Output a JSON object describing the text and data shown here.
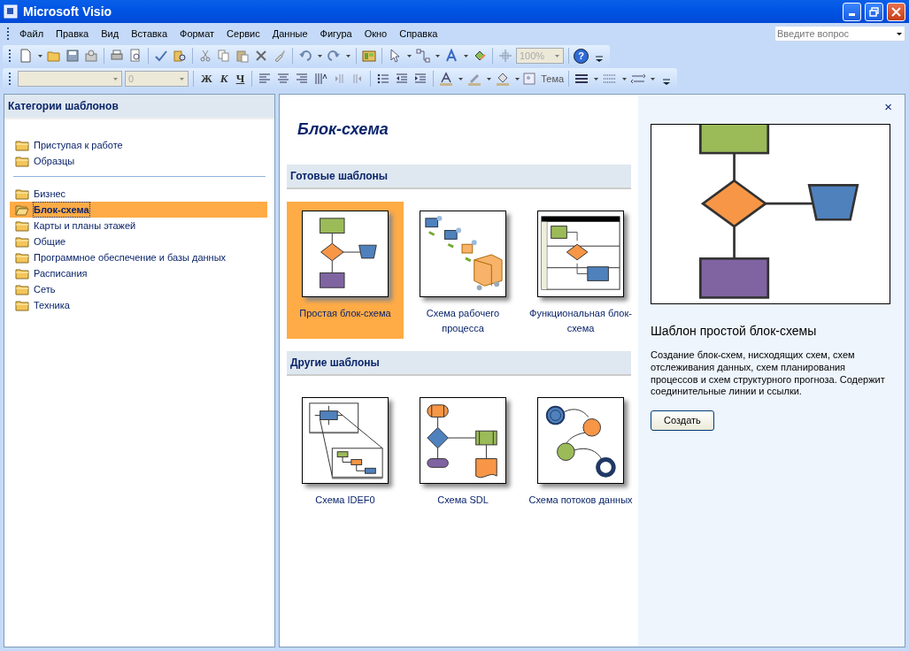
{
  "window": {
    "title": "Microsoft Visio"
  },
  "menu": [
    "Файл",
    "Правка",
    "Вид",
    "Вставка",
    "Формат",
    "Сервис",
    "Данные",
    "Фигура",
    "Окно",
    "Справка"
  ],
  "help_search": {
    "placeholder": "Введите вопрос"
  },
  "toolbar_standard": {
    "zoom": "100%",
    "help": "?"
  },
  "toolbar_format": {
    "size": "0",
    "bold": "Ж",
    "italic": "К",
    "underline": "Ч",
    "theme": "Тема"
  },
  "categories_panel": {
    "title": "Категории шаблонов",
    "groups": [
      [
        {
          "label": "Приступая к работе",
          "selected": false
        },
        {
          "label": "Образцы",
          "selected": false
        }
      ],
      [
        {
          "label": "Бизнес",
          "selected": false
        },
        {
          "label": "Блок-схема",
          "selected": true
        },
        {
          "label": "Карты и планы этажей",
          "selected": false
        },
        {
          "label": "Общие",
          "selected": false
        },
        {
          "label": "Программное обеспечение и базы данных",
          "selected": false
        },
        {
          "label": "Расписания",
          "selected": false
        },
        {
          "label": "Сеть",
          "selected": false
        },
        {
          "label": "Техника",
          "selected": false
        }
      ]
    ]
  },
  "gallery": {
    "title": "Блок-схема",
    "sections": [
      {
        "title": "Готовые шаблоны",
        "templates": [
          {
            "label": "Простая блок-схема",
            "kind": "flowchart",
            "selected": true
          },
          {
            "label": "Схема рабочего процесса",
            "kind": "workflow",
            "selected": false
          },
          {
            "label": "Функциональная блок-схема",
            "kind": "swimlane",
            "selected": false
          }
        ]
      },
      {
        "title": "Другие шаблоны",
        "templates": [
          {
            "label": "Схема IDEF0",
            "kind": "idef0",
            "selected": false
          },
          {
            "label": "Схема SDL",
            "kind": "sdl",
            "selected": false
          },
          {
            "label": "Схема потоков данных",
            "kind": "dataflow",
            "selected": false
          }
        ]
      }
    ]
  },
  "details": {
    "close": "×",
    "title": "Шаблон простой блок-схемы",
    "description": "Создание блок-схем, нисходящих схем, схем отслеживания данных, схем планирования процессов и схем структурного прогноза. Содержит соединительные линии и ссылки.",
    "button": "Создать"
  }
}
